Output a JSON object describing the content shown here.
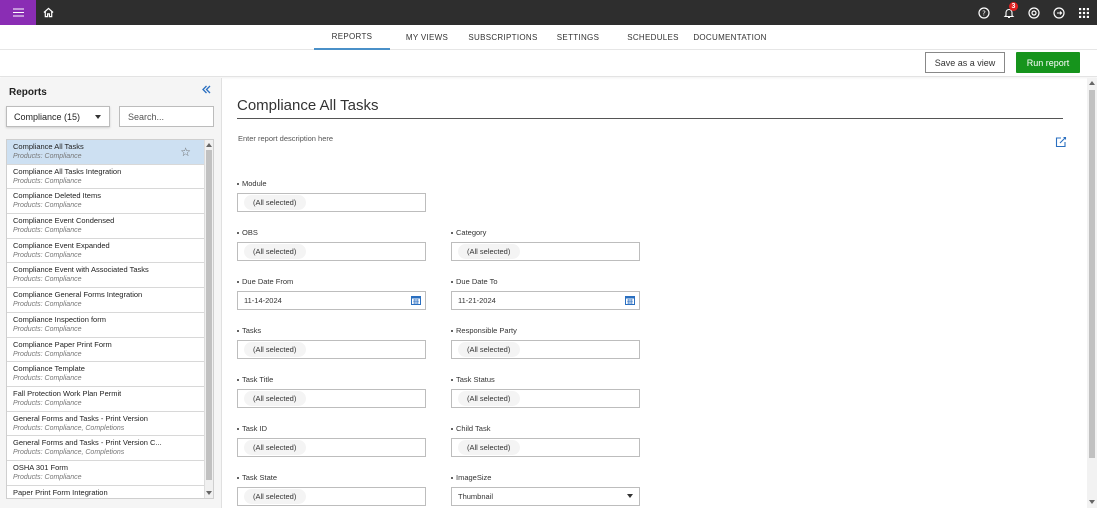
{
  "topbar": {
    "icons": [
      "menu-icon",
      "home-icon",
      "help-icon",
      "notification-bell-icon",
      "support-icon",
      "logout-icon",
      "apps-grid-icon"
    ],
    "notification_count": "3",
    "accent_color": "#8a2db4"
  },
  "tabs": [
    {
      "label": "REPORTS",
      "active": true
    },
    {
      "label": "MY VIEWS"
    },
    {
      "label": "SUBSCRIPTIONS"
    },
    {
      "label": "SETTINGS"
    },
    {
      "label": "SCHEDULES"
    },
    {
      "label": "DOCUMENTATION"
    }
  ],
  "actions": {
    "save_view_label": "Save as a view",
    "run_report_label": "Run report",
    "run_color": "#16941c"
  },
  "sidebar": {
    "title": "Reports",
    "category_select": "Compliance (15)",
    "search_placeholder": "Search...",
    "reports": [
      {
        "name": "Compliance All Tasks",
        "sub": "Products: Compliance",
        "selected": true
      },
      {
        "name": "Compliance All Tasks Integration",
        "sub": "Products: Compliance"
      },
      {
        "name": "Compliance Deleted Items",
        "sub": "Products: Compliance"
      },
      {
        "name": "Compliance Event Condensed",
        "sub": "Products: Compliance"
      },
      {
        "name": "Compliance Event Expanded",
        "sub": "Products: Compliance"
      },
      {
        "name": "Compliance Event with Associated Tasks",
        "sub": "Products: Compliance"
      },
      {
        "name": "Compliance General Forms Integration",
        "sub": "Products: Compliance"
      },
      {
        "name": "Compliance Inspection form",
        "sub": "Products: Compliance"
      },
      {
        "name": "Compliance Paper Print Form",
        "sub": "Products: Compliance"
      },
      {
        "name": "Compliance Template",
        "sub": "Products: Compliance"
      },
      {
        "name": "Fall Protection Work Plan Permit",
        "sub": "Products: Compliance"
      },
      {
        "name": "General Forms and Tasks - Print Version",
        "sub": "Products: Compliance, Completions"
      },
      {
        "name": "General Forms and Tasks - Print Version C...",
        "sub": "Products: Compliance, Completions"
      },
      {
        "name": "OSHA 301 Form",
        "sub": "Products: Compliance"
      },
      {
        "name": "Paper Print Form Integration",
        "sub": ""
      }
    ]
  },
  "main": {
    "title": "Compliance All Tasks",
    "description_placeholder": "Enter report description here",
    "fields": {
      "module": {
        "label": "Module",
        "value": "(All selected)"
      },
      "obs": {
        "label": "OBS",
        "value": "(All selected)"
      },
      "category": {
        "label": "Category",
        "value": "(All selected)"
      },
      "due_from": {
        "label": "Due Date From",
        "value": "11-14-2024"
      },
      "due_to": {
        "label": "Due Date To",
        "value": "11-21-2024"
      },
      "tasks": {
        "label": "Tasks",
        "value": "(All selected)"
      },
      "responsible": {
        "label": "Responsible Party",
        "value": "(All selected)"
      },
      "task_title": {
        "label": "Task Title",
        "value": "(All selected)"
      },
      "task_status": {
        "label": "Task Status",
        "value": "(All selected)"
      },
      "task_id": {
        "label": "Task ID",
        "value": "(All selected)"
      },
      "child_task": {
        "label": "Child Task",
        "value": "(All selected)"
      },
      "task_state": {
        "label": "Task State",
        "value": "(All selected)"
      },
      "image_size": {
        "label": "ImageSize",
        "value": "Thumbnail"
      }
    }
  }
}
